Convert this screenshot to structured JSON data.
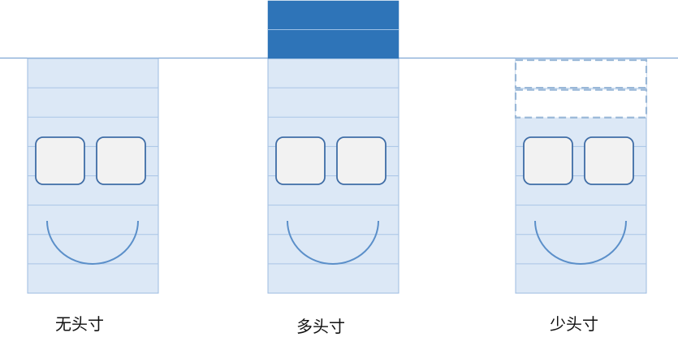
{
  "diagram": {
    "panels": [
      {
        "caption": "无头寸",
        "extra_rows": 0,
        "style": "none"
      },
      {
        "caption": "多头寸",
        "extra_rows": 2,
        "style": "filled"
      },
      {
        "caption": "少头寸",
        "extra_rows": 2,
        "style": "dashed"
      }
    ],
    "colors": {
      "face_fill": "#dce8f6",
      "face_stroke": "#9cbbe0",
      "row_line": "#a9c5e6",
      "baseline": "#7fa7d4",
      "eye_fill": "#f2f2f2",
      "eye_stroke": "#3f6da6",
      "smile": "#5b8fc9",
      "filled_block": "#2e74b8",
      "filled_divider": "#9dc1e6",
      "dashed_stroke": "#9ab8d8"
    }
  }
}
